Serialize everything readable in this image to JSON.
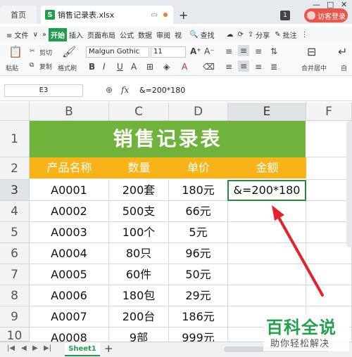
{
  "titlebar": {
    "home_tab": "首页",
    "file_tab": "销售记录表.xlsx",
    "new_tab": "+",
    "page_badge": "1",
    "login": "访客登录"
  },
  "menubar": {
    "items": [
      "≡ 文件",
      "∨",
      "»",
      "开始",
      "插入",
      "页面布局",
      "公式",
      "数据",
      "审阅",
      "视"
    ],
    "search": "查找",
    "share": "分享",
    "comment": "批注"
  },
  "ribbon": {
    "paste": "粘贴",
    "cut": "剪切",
    "copy": "复制",
    "format_painter": "格式刷",
    "font_name": "Malgun Gothic",
    "font_size": "11",
    "merge_center": "合并居中",
    "auto": "自"
  },
  "formula_bar": {
    "cell_ref": "E3",
    "fx": "fx",
    "formula": "&=200*180"
  },
  "grid": {
    "columns": [
      "B",
      "C",
      "D",
      "E",
      "F"
    ],
    "rows": [
      "1",
      "2",
      "3",
      "4",
      "5",
      "6",
      "7",
      "8",
      "9",
      "10"
    ],
    "title": "销售记录表",
    "headers": [
      "产品名称",
      "数量",
      "单价",
      "金额"
    ],
    "data": [
      [
        "A0001",
        "200套",
        "180元",
        "&=200*180"
      ],
      [
        "A0002",
        "500支",
        "66元",
        ""
      ],
      [
        "A0003",
        "100个",
        "5元",
        ""
      ],
      [
        "A0004",
        "80只",
        "96元",
        ""
      ],
      [
        "A0005",
        "60件",
        "50元",
        ""
      ],
      [
        "A0006",
        "180包",
        "29元",
        ""
      ],
      [
        "A0007",
        "200台",
        "186元",
        ""
      ],
      [
        "A0008",
        "9部",
        "999元",
        ""
      ]
    ]
  },
  "sheets": {
    "active": "Sheet1",
    "add": "+"
  },
  "watermark": {
    "brand": "百科全说",
    "slogan": "助你轻松解决"
  },
  "colors": {
    "title_green": "#6fb33d",
    "header_orange": "#f8b318",
    "arrow_red": "#e5212a",
    "brand_green": "#22a04b"
  }
}
